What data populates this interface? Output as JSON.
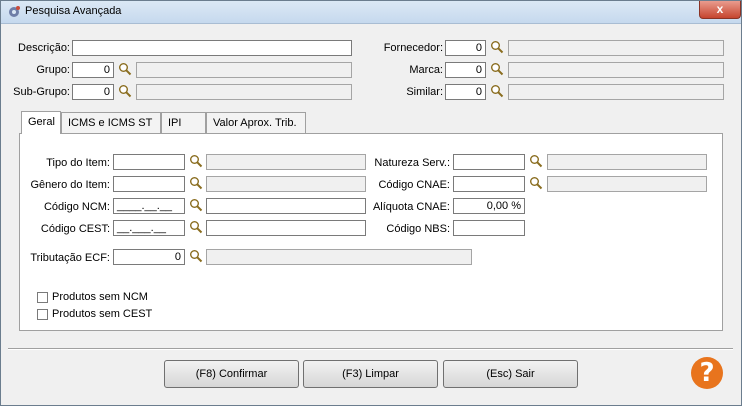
{
  "window": {
    "title": "Pesquisa Avançada",
    "close_label": "x"
  },
  "top": {
    "descricao": {
      "label": "Descrição:",
      "value": ""
    },
    "grupo": {
      "label": "Grupo:",
      "code": "0",
      "desc": ""
    },
    "subgrupo": {
      "label": "Sub-Grupo:",
      "code": "0",
      "desc": ""
    },
    "fornecedor": {
      "label": "Fornecedor:",
      "code": "0",
      "desc": ""
    },
    "marca": {
      "label": "Marca:",
      "code": "0",
      "desc": ""
    },
    "similar": {
      "label": "Similar:",
      "code": "0",
      "desc": ""
    }
  },
  "tabs": [
    {
      "label": "Geral",
      "active": true
    },
    {
      "label": "ICMS e ICMS ST",
      "active": false
    },
    {
      "label": "IPI",
      "active": false
    },
    {
      "label": "Valor Aprox. Trib.",
      "active": false
    }
  ],
  "geral": {
    "tipo_item": {
      "label": "Tipo do Item:",
      "code": "",
      "desc": ""
    },
    "genero_item": {
      "label": "Gênero do Item:",
      "code": "",
      "desc": ""
    },
    "codigo_ncm": {
      "label": "Código NCM:",
      "code": "____.__.__",
      "desc": ""
    },
    "codigo_cest": {
      "label": "Código CEST:",
      "code": "__.___.__",
      "desc": ""
    },
    "tributacao_ecf": {
      "label": "Tributação ECF:",
      "code": "0",
      "desc": ""
    },
    "natureza_serv": {
      "label": "Natureza Serv.:",
      "code": "",
      "desc": ""
    },
    "codigo_cnae": {
      "label": "Código CNAE:",
      "code": "",
      "desc": ""
    },
    "aliquota_cnae": {
      "label": "Alíquota CNAE:",
      "value": "0,00 %"
    },
    "codigo_nbs": {
      "label": "Código NBS:",
      "value": ""
    },
    "produtos_sem_ncm": {
      "label": "Produtos sem NCM",
      "checked": false
    },
    "produtos_sem_cest": {
      "label": "Produtos sem CEST",
      "checked": false
    }
  },
  "buttons": {
    "confirmar": "(F8) Confirmar",
    "limpar": "(F3) Limpar",
    "sair": "(Esc) Sair",
    "help": "?"
  },
  "colors": {
    "help_orange": "#e8741d",
    "close_red": "#c6452f"
  }
}
